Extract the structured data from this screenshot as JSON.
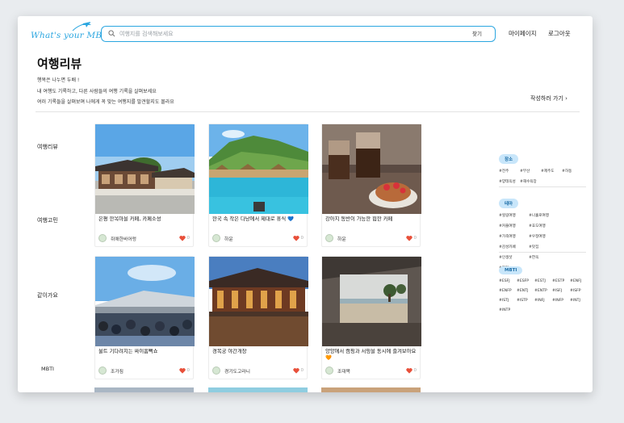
{
  "header": {
    "logo_text": "What's your MBTI",
    "search_placeholder": "여행지를 검색해보세요",
    "search_button": "찾기",
    "nav_mypage": "마이페이지",
    "nav_logout": "로그아웃"
  },
  "intro": {
    "title": "여행리뷰",
    "lines": [
      "행복은 나누면 두배 !",
      "내 여행도 기록하고, 다른 사람들의 여행 기록을 살펴보세요",
      "여러 기록들을 살펴보며 나에게 꼭 맞는 여행지를 발견할지도 몰라요"
    ],
    "write_link": "작성하러 가기 ›"
  },
  "sidebar": {
    "items": [
      {
        "label": "여행리뷰"
      },
      {
        "label": "여행고민"
      },
      {
        "label": "같이가요"
      },
      {
        "label": "MBTI"
      }
    ]
  },
  "cards": [
    {
      "title": "은평 한옥마을 카페, 카페소성",
      "user": "쥐애한바어렁",
      "likes": "0"
    },
    {
      "title": "한국 속 작은 다낭에서 제대로 휴식 💙",
      "user": "하윤",
      "likes": "0"
    },
    {
      "title": "강아지 동반이 가능한 힙한 카페",
      "user": "하윤",
      "likes": "0"
    },
    {
      "title": "울트 기다려지는 싸이흠뻑쇼",
      "user": "조가짐",
      "likes": "0"
    },
    {
      "title": "경복궁 야간개장",
      "user": "경기도고라니",
      "likes": "0"
    },
    {
      "title": "양양에서 캠핑과 서핑을 동시에 즐겨보아요 🧡",
      "user": "조대목",
      "likes": "0"
    }
  ],
  "filters": {
    "region": {
      "label": "장소",
      "tags": [
        "#전주",
        "#부산",
        "#제주도",
        "#하동",
        "#양테옥성",
        "#해수욕장"
      ]
    },
    "theme": {
      "label": "테마",
      "tags": [
        "#힐링여행",
        "#나홀로여행",
        "#커플여행",
        "#효도여행",
        "#가족여행",
        "#우정여행",
        "#감성카페",
        "#맛집",
        "#인생샷",
        "#한옥",
        "#자연"
      ]
    },
    "mbti": {
      "label": "MBTI",
      "tags": [
        "#ESFJ",
        "#ESFP",
        "#ESTJ",
        "#ESTP",
        "#ENFJ",
        "#ENFP",
        "#ENTJ",
        "#ENTP",
        "#ISFJ",
        "#ISFP",
        "#ISTJ",
        "#ISTP",
        "#INFJ",
        "#INFP",
        "#INTJ",
        "#INTP"
      ]
    }
  },
  "colors": {
    "accent": "#2ba6e0",
    "heart": "#e8503a",
    "pill_bg": "#c8e6fa"
  }
}
